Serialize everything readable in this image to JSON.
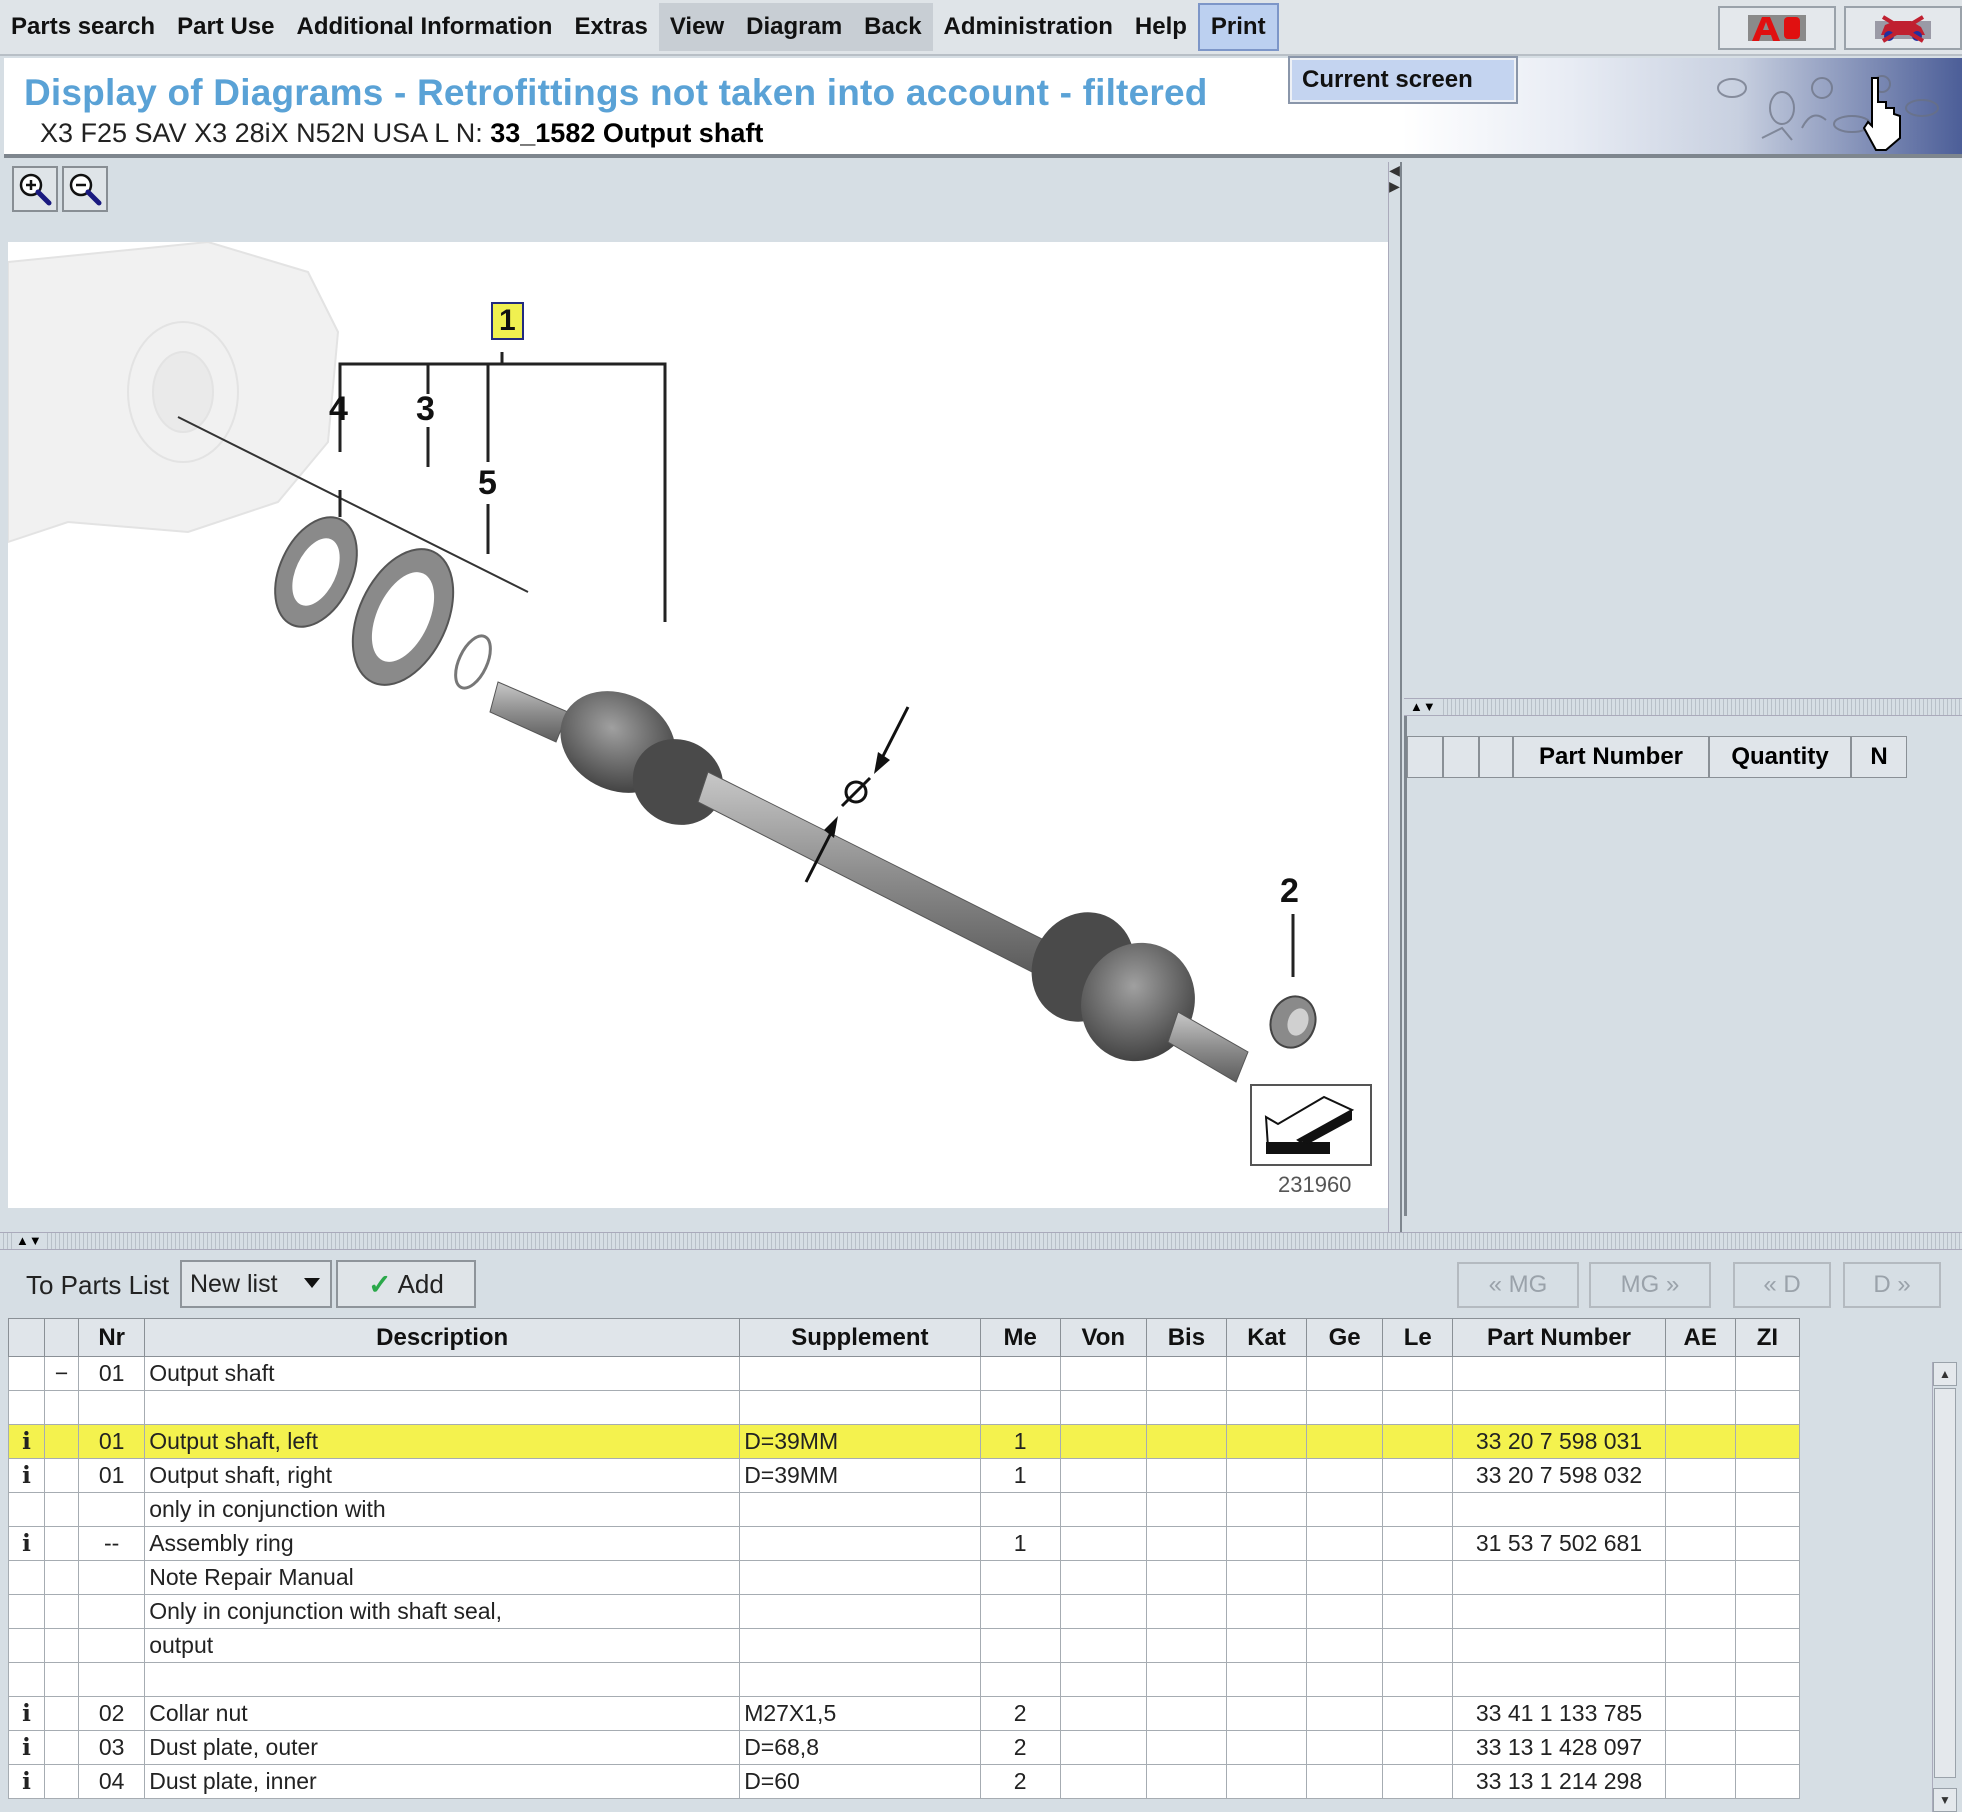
{
  "menubar": {
    "items": [
      {
        "label": "Parts search"
      },
      {
        "label": "Part Use"
      },
      {
        "label": "Additional Information"
      },
      {
        "label": "Extras"
      },
      {
        "label": "View"
      },
      {
        "label": "Diagram"
      },
      {
        "label": "Back"
      },
      {
        "label": "Administration"
      },
      {
        "label": "Help"
      },
      {
        "label": "Print"
      }
    ],
    "print_dropdown": {
      "items": [
        {
          "label": "Current screen"
        }
      ]
    },
    "tool_buttons": [
      {
        "icon": "warning-a-icon"
      },
      {
        "icon": "vehicle-icon"
      }
    ]
  },
  "header": {
    "title": "Display of Diagrams - Retrofittings not taken into account - filtered",
    "vehicle": "X3 F25 SAV X3 28iX N52N USA  L N:",
    "group": "33_1582 Output shaft"
  },
  "diagram": {
    "zoom_in": "zoom-in-icon",
    "zoom_out": "zoom-out-icon",
    "callouts": [
      "1",
      "2",
      "3",
      "4",
      "5"
    ],
    "image_id": "231960"
  },
  "right_panel": {
    "columns": [
      "",
      "",
      "",
      "Part Number",
      "Quantity",
      "N"
    ]
  },
  "toolbar": {
    "to_parts_list_label": "To Parts List",
    "list_select_value": "New list",
    "add_label": "Add",
    "nav_buttons": [
      "« MG",
      "MG »",
      "« D",
      "D »"
    ]
  },
  "parts_table": {
    "columns": [
      "",
      "",
      "Nr",
      "Description",
      "Supplement",
      "Me",
      "Von",
      "Bis",
      "Kat",
      "Ge",
      "Le",
      "Part Number",
      "AE",
      "ZI"
    ],
    "rows": [
      {
        "info": "",
        "tree": "−",
        "nr": "01",
        "desc": "Output shaft",
        "supp": "",
        "me": "",
        "pn": "",
        "highlight": false
      },
      {
        "info": "",
        "tree": "",
        "nr": "",
        "desc": "",
        "supp": "",
        "me": "",
        "pn": "",
        "highlight": false
      },
      {
        "info": "i",
        "tree": "",
        "nr": "01",
        "desc": "Output shaft, left",
        "supp": "D=39MM",
        "me": "1",
        "pn": "33 20 7 598 031",
        "highlight": true
      },
      {
        "info": "i",
        "tree": "",
        "nr": "01",
        "desc": "Output shaft, right",
        "supp": "D=39MM",
        "me": "1",
        "pn": "33 20 7 598 032",
        "highlight": false
      },
      {
        "info": "",
        "tree": "",
        "nr": "",
        "desc": "only in conjunction with",
        "supp": "",
        "me": "",
        "pn": "",
        "highlight": false
      },
      {
        "info": "i",
        "tree": "",
        "nr": "--",
        "desc": "Assembly ring",
        "supp": "",
        "me": "1",
        "pn": "31 53 7 502 681",
        "highlight": false
      },
      {
        "info": "",
        "tree": "",
        "nr": "",
        "desc": "Note Repair Manual",
        "supp": "",
        "me": "",
        "pn": "",
        "highlight": false
      },
      {
        "info": "",
        "tree": "",
        "nr": "",
        "desc": "Only in conjunction with shaft seal,",
        "supp": "",
        "me": "",
        "pn": "",
        "highlight": false
      },
      {
        "info": "",
        "tree": "",
        "nr": "",
        "desc": "output",
        "supp": "",
        "me": "",
        "pn": "",
        "highlight": false
      },
      {
        "info": "",
        "tree": "",
        "nr": "",
        "desc": "",
        "supp": "",
        "me": "",
        "pn": "",
        "highlight": false
      },
      {
        "info": "i",
        "tree": "",
        "nr": "02",
        "desc": "Collar nut",
        "supp": "M27X1,5",
        "me": "2",
        "pn": "33 41 1 133 785",
        "highlight": false
      },
      {
        "info": "i",
        "tree": "",
        "nr": "03",
        "desc": "Dust plate, outer",
        "supp": "D=68,8",
        "me": "2",
        "pn": "33 13 1 428 097",
        "highlight": false
      },
      {
        "info": "i",
        "tree": "",
        "nr": "04",
        "desc": "Dust plate, inner",
        "supp": "D=60",
        "me": "2",
        "pn": "33 13 1 214 298",
        "highlight": false
      }
    ]
  },
  "colors": {
    "title_blue": "#5aa2d6",
    "highlight_yellow": "#f4f24e",
    "info_red": "#c8103c",
    "panel_bg": "#d6dee4"
  }
}
